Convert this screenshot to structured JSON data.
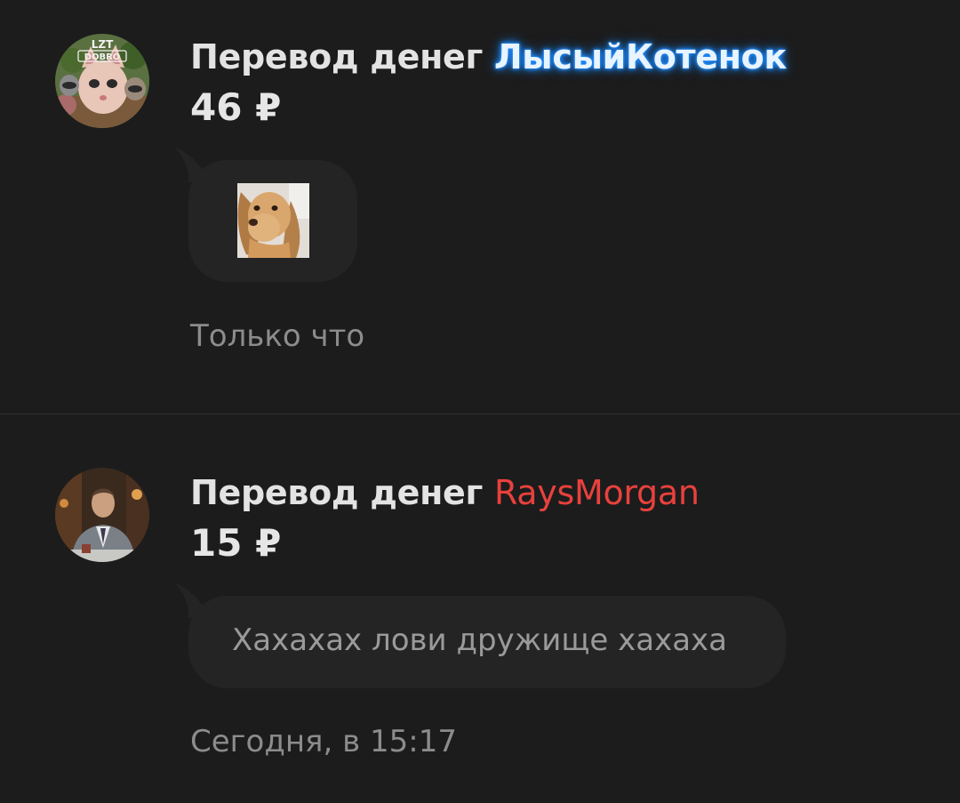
{
  "transfers": [
    {
      "title_prefix": "Перевод денег",
      "username": "ЛысыйКотенок",
      "username_color": "#1e8cff",
      "amount": "46 ₽",
      "message_type": "sticker",
      "sticker": "dog-sticker-icon",
      "time": "Только что",
      "avatar": "lzt-dobro-avatar",
      "avatar_text": "LZT DOBRO"
    },
    {
      "title_prefix": "Перевод денег",
      "username": "RaysMorgan",
      "username_color": "#e8413d",
      "amount": "15 ₽",
      "message_type": "text",
      "message": "Хахахах лови дружище хахаха",
      "time": "Сегодня, в 15:17",
      "avatar": "man-in-suit-avatar"
    }
  ]
}
